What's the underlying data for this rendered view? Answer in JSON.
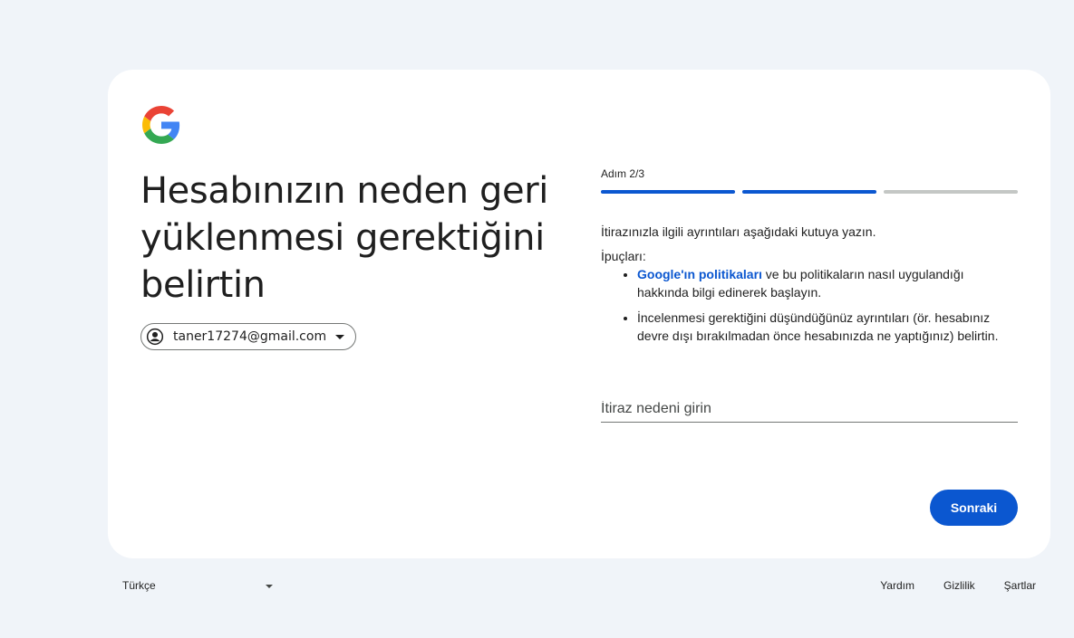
{
  "brand": {
    "logo_icon": "google-g-logo-icon",
    "colors": {
      "blue": "#4285F4",
      "red": "#EA4335",
      "yellow": "#FBBC05",
      "green": "#34A853"
    }
  },
  "headline": "Hesabınızın neden geri yüklenmesi gerektiğini belirtin",
  "account": {
    "avatar_icon": "account-circle-icon",
    "email": "taner17274@gmail.com",
    "dropdown_icon": "chevron-down-icon"
  },
  "step": {
    "label": "Adım 2/3",
    "current": 2,
    "total": 3
  },
  "instructions": "İtirazınızla ilgili ayrıntıları aşağıdaki kutuya yazın.",
  "tips": {
    "title": "İpuçları:",
    "item1_link": "Google'ın politikaları",
    "item1_text": " ve bu politikaların nasıl uygulandığı hakkında bilgi edinerek başlayın.",
    "item2_text": "İncelenmesi gerektiğini düşündüğünüz ayrıntıları (ör. hesabınız devre dışı bırakılmadan önce hesabınızda ne yaptığınız) belirtin."
  },
  "reason_field": {
    "placeholder": "İtiraz nedeni girin",
    "value": ""
  },
  "next_button": "Sonraki",
  "footer": {
    "language": "Türkçe",
    "help": "Yardım",
    "privacy": "Gizlilik",
    "terms": "Şartlar"
  },
  "accent_color": "#0b57d0"
}
